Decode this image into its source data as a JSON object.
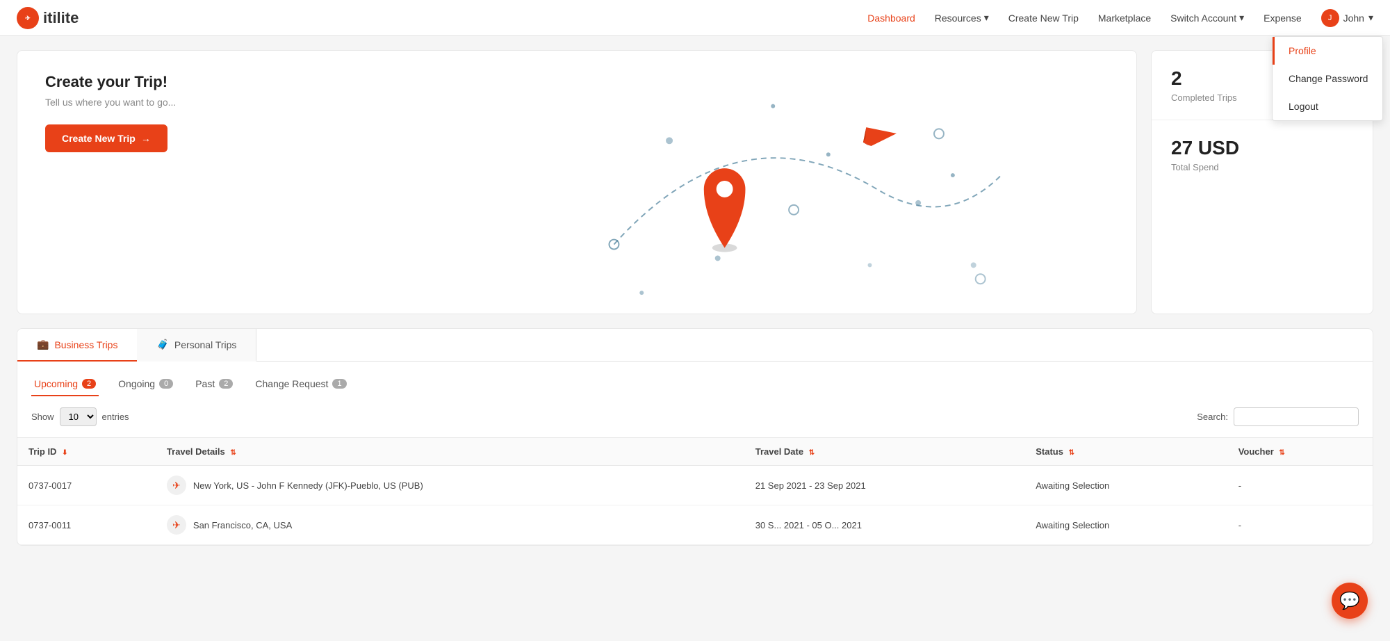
{
  "brand": {
    "logo_text": "itilite",
    "logo_icon": "✈"
  },
  "navbar": {
    "links": [
      {
        "id": "dashboard",
        "label": "Dashboard",
        "active": true
      },
      {
        "id": "resources",
        "label": "Resources",
        "has_dropdown": true
      },
      {
        "id": "create-new-trip",
        "label": "Create New Trip"
      },
      {
        "id": "marketplace",
        "label": "Marketplace"
      },
      {
        "id": "switch-account",
        "label": "Switch Account",
        "has_dropdown": true
      },
      {
        "id": "expense",
        "label": "Expense"
      }
    ],
    "user": {
      "name": "John",
      "avatar": "J"
    }
  },
  "dropdown_menu": {
    "items": [
      {
        "id": "profile",
        "label": "Profile",
        "active": true
      },
      {
        "id": "change-password",
        "label": "Change Password"
      },
      {
        "id": "logout",
        "label": "Logout"
      }
    ]
  },
  "hero": {
    "title": "Create your Trip!",
    "subtitle": "Tell us where you want to go...",
    "btn_label": "Create New Trip",
    "btn_arrow": "→"
  },
  "stats": [
    {
      "id": "completed-trips",
      "number": "2",
      "label": "Completed Trips"
    },
    {
      "id": "total-spend",
      "number": "27 USD",
      "label": "Total Spend"
    }
  ],
  "trip_tabs": [
    {
      "id": "business-trips",
      "label": "Business Trips",
      "active": true
    },
    {
      "id": "personal-trips",
      "label": "Personal Trips",
      "active": false
    }
  ],
  "sub_tabs": [
    {
      "id": "upcoming",
      "label": "Upcoming",
      "count": "2",
      "active": true
    },
    {
      "id": "ongoing",
      "label": "Ongoing",
      "count": "0",
      "active": false
    },
    {
      "id": "past",
      "label": "Past",
      "count": "2",
      "active": false
    },
    {
      "id": "change-request",
      "label": "Change Request",
      "count": "1",
      "active": false
    }
  ],
  "table_controls": {
    "show_label": "Show",
    "entries_value": "10",
    "entries_label": "entries",
    "search_label": "Search:",
    "search_placeholder": ""
  },
  "table": {
    "columns": [
      {
        "id": "trip-id",
        "label": "Trip ID"
      },
      {
        "id": "travel-details",
        "label": "Travel Details"
      },
      {
        "id": "travel-date",
        "label": "Travel Date"
      },
      {
        "id": "status",
        "label": "Status"
      },
      {
        "id": "voucher",
        "label": "Voucher"
      }
    ],
    "rows": [
      {
        "trip_id": "0737-0017",
        "travel_details": "New York, US - John F Kennedy (JFK)-Pueblo, US (PUB)",
        "travel_date": "21 Sep 2021 - 23 Sep 2021",
        "status": "Awaiting Selection",
        "voucher": "-"
      },
      {
        "trip_id": "0737-0011",
        "travel_details": "San Francisco, CA, USA",
        "travel_date": "30 S... 2021 - 05 O... 2021",
        "status": "Awaiting Selection",
        "voucher": "-"
      }
    ]
  },
  "fab": {
    "icon": "💬"
  }
}
